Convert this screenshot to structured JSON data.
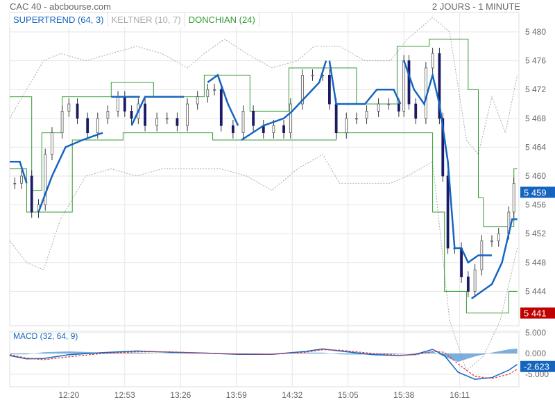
{
  "header": {
    "title": "CAC 40 - abcbourse.com",
    "period": "2 JOURS - 1 MINUTE"
  },
  "legend": [
    {
      "label": "SUPERTREND (64, 3)",
      "color": "#0055bb"
    },
    {
      "label": "KELTNER (10, 7)",
      "color": "#aaaaaa"
    },
    {
      "label": "DONCHIAN (24)",
      "color": "#339933"
    }
  ],
  "colors": {
    "price": "#1a1a66",
    "supertrend": "#1565c0",
    "keltner": "#aaaaaa",
    "donchian": "#339933",
    "last_flag": "#1565c0",
    "low_flag": "#c00000"
  },
  "chart_data": [
    {
      "type": "line",
      "title": "CAC 40",
      "ylim": [
        5440,
        5482
      ],
      "y_ticks": [
        "5 444",
        "5 448",
        "5 452",
        "5 456",
        "5 460",
        "5 464",
        "5 468",
        "5 472",
        "5 476",
        "5 480"
      ],
      "y_tick_values": [
        5444,
        5448,
        5452,
        5456,
        5460,
        5464,
        5468,
        5472,
        5476,
        5480
      ],
      "x_ticks": [
        "12:20",
        "12:53",
        "13:26",
        "13:59",
        "14:32",
        "15:05",
        "15:38",
        "16:11"
      ],
      "x_tick_minutes": [
        20,
        53,
        86,
        119,
        152,
        185,
        218,
        251
      ],
      "xlim_minutes": [
        -15,
        286
      ],
      "last_price_label": "5 459",
      "last_price": 5459,
      "low_label": "5 441",
      "low_value": 5441,
      "price": [
        [
          -12,
          5459
        ],
        [
          -8,
          5460
        ],
        [
          -2,
          5455
        ],
        [
          2,
          5456
        ],
        [
          6,
          5463
        ],
        [
          10,
          5466
        ],
        [
          16,
          5469
        ],
        [
          20,
          5470
        ],
        [
          25,
          5468
        ],
        [
          31,
          5466
        ],
        [
          37,
          5468
        ],
        [
          43,
          5469
        ],
        [
          49,
          5471
        ],
        [
          53,
          5469
        ],
        [
          57,
          5468
        ],
        [
          61,
          5470
        ],
        [
          65,
          5467
        ],
        [
          72,
          5468
        ],
        [
          78,
          5468
        ],
        [
          84,
          5467
        ],
        [
          90,
          5470
        ],
        [
          96,
          5471
        ],
        [
          102,
          5472
        ],
        [
          106,
          5472
        ],
        [
          110,
          5467
        ],
        [
          117,
          5466
        ],
        [
          123,
          5469
        ],
        [
          129,
          5467
        ],
        [
          135,
          5466
        ],
        [
          141,
          5467
        ],
        [
          147,
          5466
        ],
        [
          151,
          5470
        ],
        [
          158,
          5474
        ],
        [
          164,
          5474
        ],
        [
          170,
          5474
        ],
        [
          174,
          5470
        ],
        [
          178,
          5466
        ],
        [
          184,
          5468
        ],
        [
          190,
          5468
        ],
        [
          196,
          5469
        ],
        [
          203,
          5470
        ],
        [
          209,
          5470
        ],
        [
          215,
          5469
        ],
        [
          218,
          5476
        ],
        [
          221,
          5470
        ],
        [
          225,
          5468
        ],
        [
          231,
          5475
        ],
        [
          235,
          5477
        ],
        [
          239,
          5468
        ],
        [
          241,
          5460
        ],
        [
          244,
          5450
        ],
        [
          248,
          5450
        ],
        [
          252,
          5446
        ],
        [
          256,
          5444
        ],
        [
          260,
          5447
        ],
        [
          264,
          5451
        ],
        [
          270,
          5451
        ],
        [
          274,
          5452
        ],
        [
          280,
          5455
        ],
        [
          283,
          5459
        ]
      ],
      "supertrend": [
        [
          [
            -15,
            5462
          ],
          [
            -9,
            5462
          ],
          [
            -5,
            5459
          ]
        ],
        [
          [
            2,
            5455
          ],
          [
            10,
            5460
          ],
          [
            18,
            5464
          ],
          [
            28,
            5465
          ],
          [
            40,
            5466
          ]
        ],
        [
          [
            45,
            5471
          ],
          [
            62,
            5471
          ]
        ],
        [
          [
            57,
            5467
          ],
          [
            65,
            5471
          ],
          [
            88,
            5471
          ]
        ],
        [
          [
            102,
            5473
          ],
          [
            108,
            5474
          ],
          [
            114,
            5470
          ],
          [
            120,
            5467
          ]
        ],
        [
          [
            122,
            5465
          ],
          [
            135,
            5467
          ],
          [
            147,
            5468
          ],
          [
            152,
            5469
          ],
          [
            160,
            5471
          ],
          [
            168,
            5473
          ],
          [
            172,
            5476
          ]
        ],
        [
          [
            174,
            5476
          ],
          [
            178,
            5470
          ],
          [
            195,
            5470
          ],
          [
            202,
            5472
          ],
          [
            212,
            5472
          ],
          [
            216,
            5470
          ]
        ],
        [
          [
            218,
            5476
          ],
          [
            224,
            5472
          ],
          [
            230,
            5470
          ],
          [
            235,
            5474
          ],
          [
            239,
            5470
          ],
          [
            244,
            5462
          ],
          [
            248,
            5450
          ],
          [
            252,
            5450
          ],
          [
            256,
            5448
          ],
          [
            262,
            5449
          ],
          [
            270,
            5449
          ]
        ],
        [
          [
            258,
            5443
          ],
          [
            264,
            5444
          ],
          [
            270,
            5445
          ],
          [
            276,
            5448
          ],
          [
            282,
            5454
          ],
          [
            285,
            5454
          ]
        ]
      ],
      "donchian_upper": [
        [
          -15,
          5471
        ],
        [
          -2,
          5471
        ],
        [
          -2,
          5458
        ],
        [
          4,
          5458
        ],
        [
          4,
          5466
        ],
        [
          16,
          5466
        ],
        [
          16,
          5471
        ],
        [
          45,
          5471
        ],
        [
          45,
          5473
        ],
        [
          70,
          5473
        ],
        [
          70,
          5471
        ],
        [
          100,
          5471
        ],
        [
          100,
          5474
        ],
        [
          127,
          5474
        ],
        [
          127,
          5469
        ],
        [
          150,
          5469
        ],
        [
          150,
          5475
        ],
        [
          190,
          5475
        ],
        [
          190,
          5470
        ],
        [
          214,
          5470
        ],
        [
          214,
          5478
        ],
        [
          233,
          5478
        ],
        [
          233,
          5479
        ],
        [
          256,
          5479
        ],
        [
          256,
          5472
        ],
        [
          262,
          5472
        ],
        [
          262,
          5457
        ],
        [
          265,
          5457
        ],
        [
          265,
          5453
        ],
        [
          283,
          5453
        ],
        [
          283,
          5461
        ],
        [
          285,
          5461
        ]
      ],
      "donchian_lower": [
        [
          -15,
          5461
        ],
        [
          -5,
          5461
        ],
        [
          -5,
          5455
        ],
        [
          22,
          5455
        ],
        [
          22,
          5465
        ],
        [
          52,
          5465
        ],
        [
          52,
          5466
        ],
        [
          105,
          5466
        ],
        [
          105,
          5465
        ],
        [
          178,
          5465
        ],
        [
          178,
          5466
        ],
        [
          235,
          5466
        ],
        [
          235,
          5455
        ],
        [
          242,
          5455
        ],
        [
          242,
          5444
        ],
        [
          255,
          5444
        ],
        [
          255,
          5441
        ],
        [
          280,
          5441
        ],
        [
          280,
          5444
        ],
        [
          285,
          5444
        ]
      ],
      "keltner_upper": [
        [
          -15,
          5468
        ],
        [
          -5,
          5472
        ],
        [
          5,
          5476
        ],
        [
          15,
          5477
        ],
        [
          30,
          5476
        ],
        [
          45,
          5477
        ],
        [
          60,
          5478
        ],
        [
          75,
          5477
        ],
        [
          90,
          5475
        ],
        [
          100,
          5477
        ],
        [
          112,
          5479
        ],
        [
          125,
          5477
        ],
        [
          140,
          5475
        ],
        [
          155,
          5476
        ],
        [
          165,
          5478
        ],
        [
          180,
          5478
        ],
        [
          195,
          5476
        ],
        [
          210,
          5476
        ],
        [
          220,
          5479
        ],
        [
          235,
          5482
        ],
        [
          245,
          5480
        ],
        [
          255,
          5465
        ],
        [
          262,
          5463
        ],
        [
          270,
          5471
        ],
        [
          278,
          5466
        ],
        [
          285,
          5474
        ]
      ],
      "keltner_lower": [
        [
          -15,
          5451
        ],
        [
          -5,
          5448
        ],
        [
          5,
          5447
        ],
        [
          15,
          5454
        ],
        [
          30,
          5460
        ],
        [
          45,
          5461
        ],
        [
          60,
          5460
        ],
        [
          75,
          5461
        ],
        [
          90,
          5461
        ],
        [
          110,
          5461
        ],
        [
          125,
          5460
        ],
        [
          140,
          5458
        ],
        [
          155,
          5461
        ],
        [
          170,
          5463
        ],
        [
          180,
          5459
        ],
        [
          195,
          5459
        ],
        [
          210,
          5459
        ],
        [
          220,
          5460
        ],
        [
          235,
          5462
        ],
        [
          245,
          5440
        ],
        [
          255,
          5433
        ],
        [
          265,
          5435
        ],
        [
          275,
          5440
        ],
        [
          285,
          5450
        ]
      ]
    },
    {
      "type": "area",
      "title": "MACD (32, 64, 9)",
      "ylim": [
        -7,
        6
      ],
      "y_ticks": [
        "5.000",
        "0.000",
        "-5.000"
      ],
      "y_tick_values": [
        5,
        0,
        -5
      ],
      "last_label": "-2.623",
      "last_value": -2.623,
      "macd": [
        [
          -15,
          -0.5
        ],
        [
          -5,
          -1.3
        ],
        [
          5,
          -1.2
        ],
        [
          20,
          -0.3
        ],
        [
          40,
          0.2
        ],
        [
          60,
          0.6
        ],
        [
          80,
          0.3
        ],
        [
          100,
          0.1
        ],
        [
          120,
          -0.2
        ],
        [
          140,
          -0.2
        ],
        [
          160,
          0.5
        ],
        [
          170,
          1.1
        ],
        [
          180,
          0.6
        ],
        [
          200,
          -0.3
        ],
        [
          215,
          -0.5
        ],
        [
          225,
          -0.2
        ],
        [
          235,
          1.0
        ],
        [
          242,
          -0.5
        ],
        [
          250,
          -4.5
        ],
        [
          260,
          -6.2
        ],
        [
          270,
          -5.8
        ],
        [
          280,
          -4.0
        ],
        [
          285,
          -2.623
        ]
      ],
      "signal": [
        [
          -15,
          -0.3
        ],
        [
          -5,
          -1.1
        ],
        [
          5,
          -1.5
        ],
        [
          20,
          -0.8
        ],
        [
          40,
          0
        ],
        [
          60,
          0.4
        ],
        [
          80,
          0.4
        ],
        [
          100,
          0.1
        ],
        [
          120,
          -0.1
        ],
        [
          140,
          -0.2
        ],
        [
          160,
          0.3
        ],
        [
          170,
          0.9
        ],
        [
          180,
          0.8
        ],
        [
          200,
          0
        ],
        [
          215,
          -0.4
        ],
        [
          225,
          -0.3
        ],
        [
          235,
          0.5
        ],
        [
          242,
          0.3
        ],
        [
          250,
          -2.5
        ],
        [
          260,
          -5.5
        ],
        [
          270,
          -6
        ],
        [
          280,
          -5
        ],
        [
          285,
          -3.8
        ]
      ]
    }
  ]
}
